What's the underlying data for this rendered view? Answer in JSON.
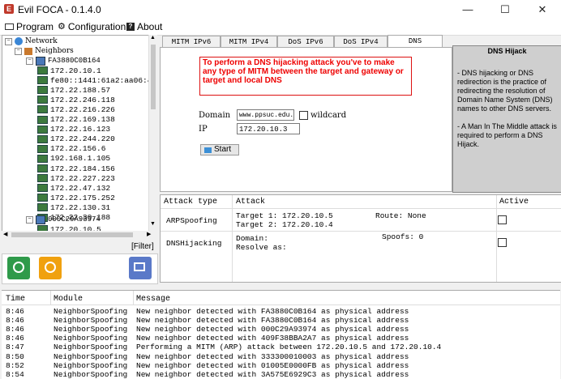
{
  "window": {
    "title": "Evil FOCA - 0.1.4.0",
    "minimize": "—",
    "maximize": "☐",
    "close": "✕"
  },
  "menu": {
    "program": "Program",
    "configuration": "Configuration",
    "about": "About"
  },
  "tree": {
    "root": "Network",
    "neighbors": "Neighbors",
    "host1": "FA3880C0B164",
    "host1_ips": [
      "172.20.10.1",
      "fe80::1441:61a2:aa06:4098",
      "172.22.188.57",
      "172.22.246.118",
      "172.22.216.226",
      "172.22.169.138",
      "172.22.16.123",
      "172.22.244.220",
      "172.22.156.6",
      "192.168.1.105",
      "172.22.184.156",
      "172.22.227.223",
      "172.22.47.132",
      "172.22.175.252",
      "172.22.130.31",
      "172.22.30.188"
    ],
    "host2": "000C29A93974",
    "host2_ips": [
      "172.20.10.5"
    ],
    "filter": "[Filter]"
  },
  "tabs": [
    "MITM IPv6",
    "MITM IPv4",
    "DoS IPv6",
    "DoS IPv4",
    "DNS Hijacking"
  ],
  "dns": {
    "warning": "To perform a DNS hijacking attack you've to make any type of MITM between the target and gateway or target and local DNS",
    "domain_label": "Domain",
    "domain_value": "www.ppsuc.edu.cn",
    "wildcard_label": "wildcard",
    "ip_label": "IP",
    "ip_value": "172.20.10.3",
    "start": "Start"
  },
  "info": {
    "title": "DNS Hijack",
    "p1": "- DNS hijacking or DNS redirection is the practice of redirecting the resolution of Domain Name System (DNS) names to other DNS servers.",
    "p2": "- A Man In The Middle attack is required to perform a DNS Hijack."
  },
  "attacks": {
    "headers": {
      "type": "Attack type",
      "attack": "Attack",
      "active": "Active"
    },
    "rows": [
      {
        "type": "ARPSpoofing",
        "line1": "Target 1: 172.20.10.5",
        "line2": "Target 2: 172.20.10.4",
        "extra": "Route: None"
      },
      {
        "type": "DNSHijacking",
        "line1": "Domain:",
        "line2": "Resolve as:",
        "extra": "Spoofs: 0"
      }
    ]
  },
  "log": {
    "headers": {
      "time": "Time",
      "module": "Module",
      "message": "Message"
    },
    "rows": [
      {
        "time": "8:46",
        "module": "NeighborSpoofing",
        "message": "New neighbor detected with FA3880C0B164 as physical address"
      },
      {
        "time": "8:46",
        "module": "NeighborSpoofing",
        "message": "New neighbor detected with FA3880C0B164 as physical address"
      },
      {
        "time": "8:46",
        "module": "NeighborSpoofing",
        "message": "New neighbor detected with 000C29A93974 as physical address"
      },
      {
        "time": "8:46",
        "module": "NeighborSpoofing",
        "message": "New neighbor detected with 409F38BBA2A7 as physical address"
      },
      {
        "time": "8:47",
        "module": "NeighborSpoofing",
        "message": "Performing a MITM (ARP) attack between 172.20.10.5 and 172.20.10.4"
      },
      {
        "time": "8:50",
        "module": "NeighborSpoofing",
        "message": "New neighbor detected with 333300010003 as physical address"
      },
      {
        "time": "8:52",
        "module": "NeighborSpoofing",
        "message": "New neighbor detected with 01005E0000FB as physical address"
      },
      {
        "time": "8:54",
        "module": "NeighborSpoofing",
        "message": "New neighbor detected with 3A575E6929C3 as physical address"
      }
    ]
  }
}
